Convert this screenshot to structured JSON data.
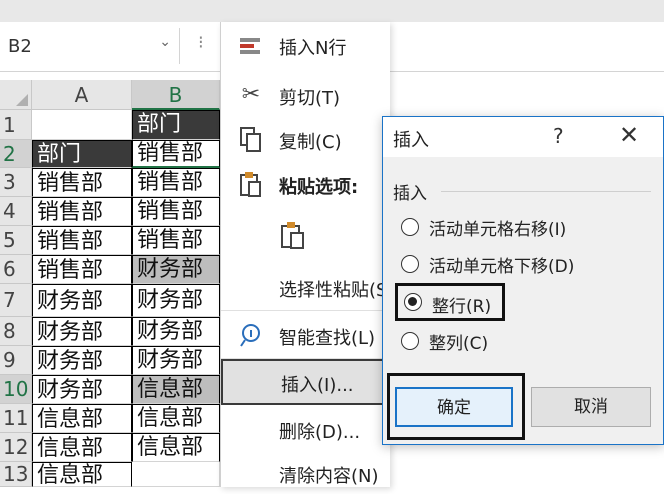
{
  "name_box": {
    "value": "B2"
  },
  "columns": [
    "A",
    "B"
  ],
  "rows": [
    {
      "num": "1",
      "a": "",
      "b": "部门"
    },
    {
      "num": "2",
      "a": "部门",
      "b": "销售部"
    },
    {
      "num": "3",
      "a": "销售部",
      "b": "销售部"
    },
    {
      "num": "4",
      "a": "销售部",
      "b": "销售部"
    },
    {
      "num": "5",
      "a": "销售部",
      "b": "销售部"
    },
    {
      "num": "6",
      "a": "销售部",
      "b": "财务部"
    },
    {
      "num": "7",
      "a": "财务部",
      "b": "财务部"
    },
    {
      "num": "8",
      "a": "财务部",
      "b": "财务部"
    },
    {
      "num": "9",
      "a": "财务部",
      "b": "财务部"
    },
    {
      "num": "10",
      "a": "财务部",
      "b": "信息部"
    },
    {
      "num": "11",
      "a": "信息部",
      "b": "信息部"
    },
    {
      "num": "12",
      "a": "信息部",
      "b": "信息部"
    },
    {
      "num": "13",
      "a": "信息部",
      "b": ""
    }
  ],
  "context_menu": {
    "insert_rows": "插入N行",
    "cut": "剪切(T)",
    "copy": "复制(C)",
    "paste_options": "粘贴选项:",
    "paste_special": "选择性粘贴(S",
    "smart_lookup": "智能查找(L)",
    "insert": "插入(I)...",
    "delete": "删除(D)...",
    "clear": "清除内容(N)"
  },
  "dialog": {
    "title": "插入",
    "help": "?",
    "close": "✕",
    "group_label": "插入",
    "options": [
      {
        "label": "活动单元格右移(I)",
        "selected": false
      },
      {
        "label": "活动单元格下移(D)",
        "selected": false
      },
      {
        "label": "整行(R)",
        "selected": true
      },
      {
        "label": "整列(C)",
        "selected": false
      }
    ],
    "ok": "确定",
    "cancel": "取消"
  },
  "colors": {
    "accent": "#217346",
    "dialog_border": "#1a73c7",
    "dark_cell": "#3a3a3a",
    "gray_cell": "#bdbdbd"
  }
}
